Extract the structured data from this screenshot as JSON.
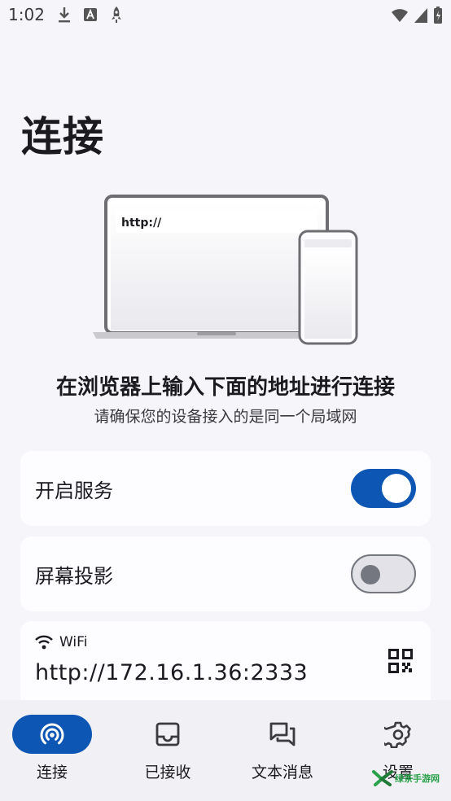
{
  "status_bar": {
    "time": "1:02"
  },
  "page": {
    "title": "连接"
  },
  "illustration": {
    "browser_url": "http://"
  },
  "instructions": {
    "headline": "在浏览器上输入下面的地址进行连接",
    "subline": "请确保您的设备接入的是同一个局域网"
  },
  "service": {
    "label": "开启服务",
    "enabled": true
  },
  "screen_cast": {
    "label": "屏幕投影",
    "enabled": false
  },
  "address": {
    "network_label": "WiFi",
    "url": "http://172.16.1.36:2333"
  },
  "nav": {
    "items": [
      {
        "label": "连接",
        "icon": "broadcast-icon",
        "active": true
      },
      {
        "label": "已接收",
        "icon": "inbox-icon",
        "active": false
      },
      {
        "label": "文本消息",
        "icon": "chat-icon",
        "active": false
      },
      {
        "label": "设置",
        "icon": "gear-icon",
        "active": false
      }
    ]
  },
  "watermark": {
    "text": "绿茶手游网"
  },
  "colors": {
    "accent": "#0d56b4",
    "background": "#f6f5fa",
    "card": "#fdfcff"
  }
}
